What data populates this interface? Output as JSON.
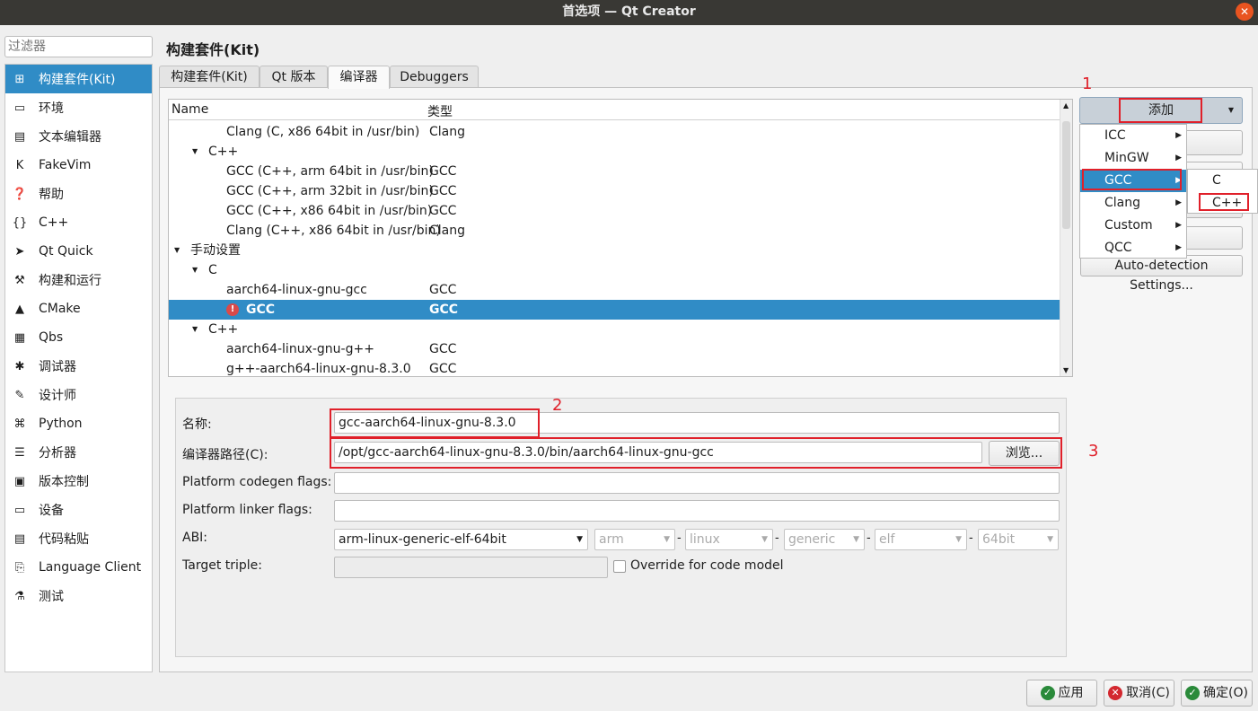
{
  "window": {
    "title": "首选项 — Qt Creator",
    "close_icon": "close-icon"
  },
  "filter": {
    "placeholder": "过滤器"
  },
  "sidebar": {
    "items": [
      {
        "label": "构建套件(Kit)",
        "icon": "kit-icon",
        "glyph": "⊞",
        "selected": true
      },
      {
        "label": "环境",
        "icon": "monitor-icon",
        "glyph": "▭"
      },
      {
        "label": "文本编辑器",
        "icon": "text-editor-icon",
        "glyph": "▤"
      },
      {
        "label": "FakeVim",
        "icon": "fakevim-icon",
        "glyph": "K"
      },
      {
        "label": "帮助",
        "icon": "help-icon",
        "glyph": "❓"
      },
      {
        "label": "C++",
        "icon": "braces-icon",
        "glyph": "{}"
      },
      {
        "label": "Qt Quick",
        "icon": "qtquick-icon",
        "glyph": "➤"
      },
      {
        "label": "构建和运行",
        "icon": "hammer-icon",
        "glyph": "⚒"
      },
      {
        "label": "CMake",
        "icon": "cmake-icon",
        "glyph": "▲"
      },
      {
        "label": "Qbs",
        "icon": "qbs-icon",
        "glyph": "▦"
      },
      {
        "label": "调试器",
        "icon": "bug-icon",
        "glyph": "✱"
      },
      {
        "label": "设计师",
        "icon": "pencil-icon",
        "glyph": "✎"
      },
      {
        "label": "Python",
        "icon": "python-icon",
        "glyph": "⌘"
      },
      {
        "label": "分析器",
        "icon": "analyzer-icon",
        "glyph": "☰"
      },
      {
        "label": "版本控制",
        "icon": "version-control-icon",
        "glyph": "▣"
      },
      {
        "label": "设备",
        "icon": "device-icon",
        "glyph": "▭"
      },
      {
        "label": "代码粘贴",
        "icon": "paste-icon",
        "glyph": "▤"
      },
      {
        "label": "Language Client",
        "icon": "language-client-icon",
        "glyph": "⎘"
      },
      {
        "label": "测试",
        "icon": "test-icon",
        "glyph": "⚗"
      }
    ]
  },
  "page_title": "构建套件(Kit)",
  "tabs": [
    {
      "label": "构建套件(Kit)"
    },
    {
      "label": "Qt 版本"
    },
    {
      "label": "编译器",
      "active": true
    },
    {
      "label": "Debuggers"
    }
  ],
  "tree": {
    "columns": [
      "Name",
      "类型"
    ],
    "rows": [
      {
        "name": "Clang (C, x86 64bit in /usr/bin)",
        "type": "Clang",
        "level": 2
      },
      {
        "name": "C++",
        "type": "",
        "level": 1,
        "expanded": true
      },
      {
        "name": "GCC (C++, arm 64bit in /usr/bin)",
        "type": "GCC",
        "level": 2
      },
      {
        "name": "GCC (C++, arm 32bit in /usr/bin)",
        "type": "GCC",
        "level": 2
      },
      {
        "name": "GCC (C++, x86 64bit in /usr/bin)",
        "type": "GCC",
        "level": 2
      },
      {
        "name": "Clang (C++, x86 64bit in /usr/bin)",
        "type": "Clang",
        "level": 2
      },
      {
        "name": "手动设置",
        "type": "",
        "level": 0,
        "expanded": true
      },
      {
        "name": "C",
        "type": "",
        "level": 1,
        "expanded": true
      },
      {
        "name": "aarch64-linux-gnu-gcc",
        "type": "GCC",
        "level": 2
      },
      {
        "name": "GCC",
        "type": "GCC",
        "level": 2,
        "selected": true,
        "icon": "error-icon"
      },
      {
        "name": "C++",
        "type": "",
        "level": 1,
        "expanded": true
      },
      {
        "name": "aarch64-linux-gnu-g++",
        "type": "GCC",
        "level": 2
      },
      {
        "name": "g++-aarch64-linux-gnu-8.3.0",
        "type": "GCC",
        "level": 2
      }
    ]
  },
  "add_button": {
    "label": "添加"
  },
  "add_menu": {
    "items": [
      {
        "label": "ICC"
      },
      {
        "label": "MinGW"
      },
      {
        "label": "GCC",
        "highlighted": true
      },
      {
        "label": "Clang"
      },
      {
        "label": "Custom"
      },
      {
        "label": "QCC"
      }
    ]
  },
  "add_submenu": {
    "items": [
      {
        "label": "C"
      },
      {
        "label": "C++"
      }
    ]
  },
  "hidden_button_tail": "t",
  "auto_detect_button": {
    "label": "Auto-detection Settings..."
  },
  "annotations": [
    "1",
    "2",
    "3"
  ],
  "form": {
    "name_label": "名称:",
    "name_value": "gcc-aarch64-linux-gnu-8.3.0",
    "path_label": "编译器路径(C):",
    "path_value": "/opt/gcc-aarch64-linux-gnu-8.3.0/bin/aarch64-linux-gnu-gcc",
    "browse_label": "浏览...",
    "codegen_label": "Platform codegen flags:",
    "codegen_value": "",
    "linker_label": "Platform linker flags:",
    "linker_value": "",
    "abi_label": "ABI:",
    "abi_value": "arm-linux-generic-elf-64bit",
    "abi_parts": [
      "arm",
      "linux",
      "generic",
      "elf",
      "64bit"
    ],
    "abi_sep": "-",
    "triple_label": "Target triple:",
    "triple_value": "",
    "override_label": "Override for code model",
    "override_checked": false
  },
  "footer": {
    "apply": "应用",
    "cancel": "取消(C)",
    "ok": "确定(O)"
  },
  "colors": {
    "accent": "#308cc6",
    "annotation": "#e0202a",
    "ok_icon": "#2a8a3a",
    "cancel_icon": "#d3282f"
  }
}
